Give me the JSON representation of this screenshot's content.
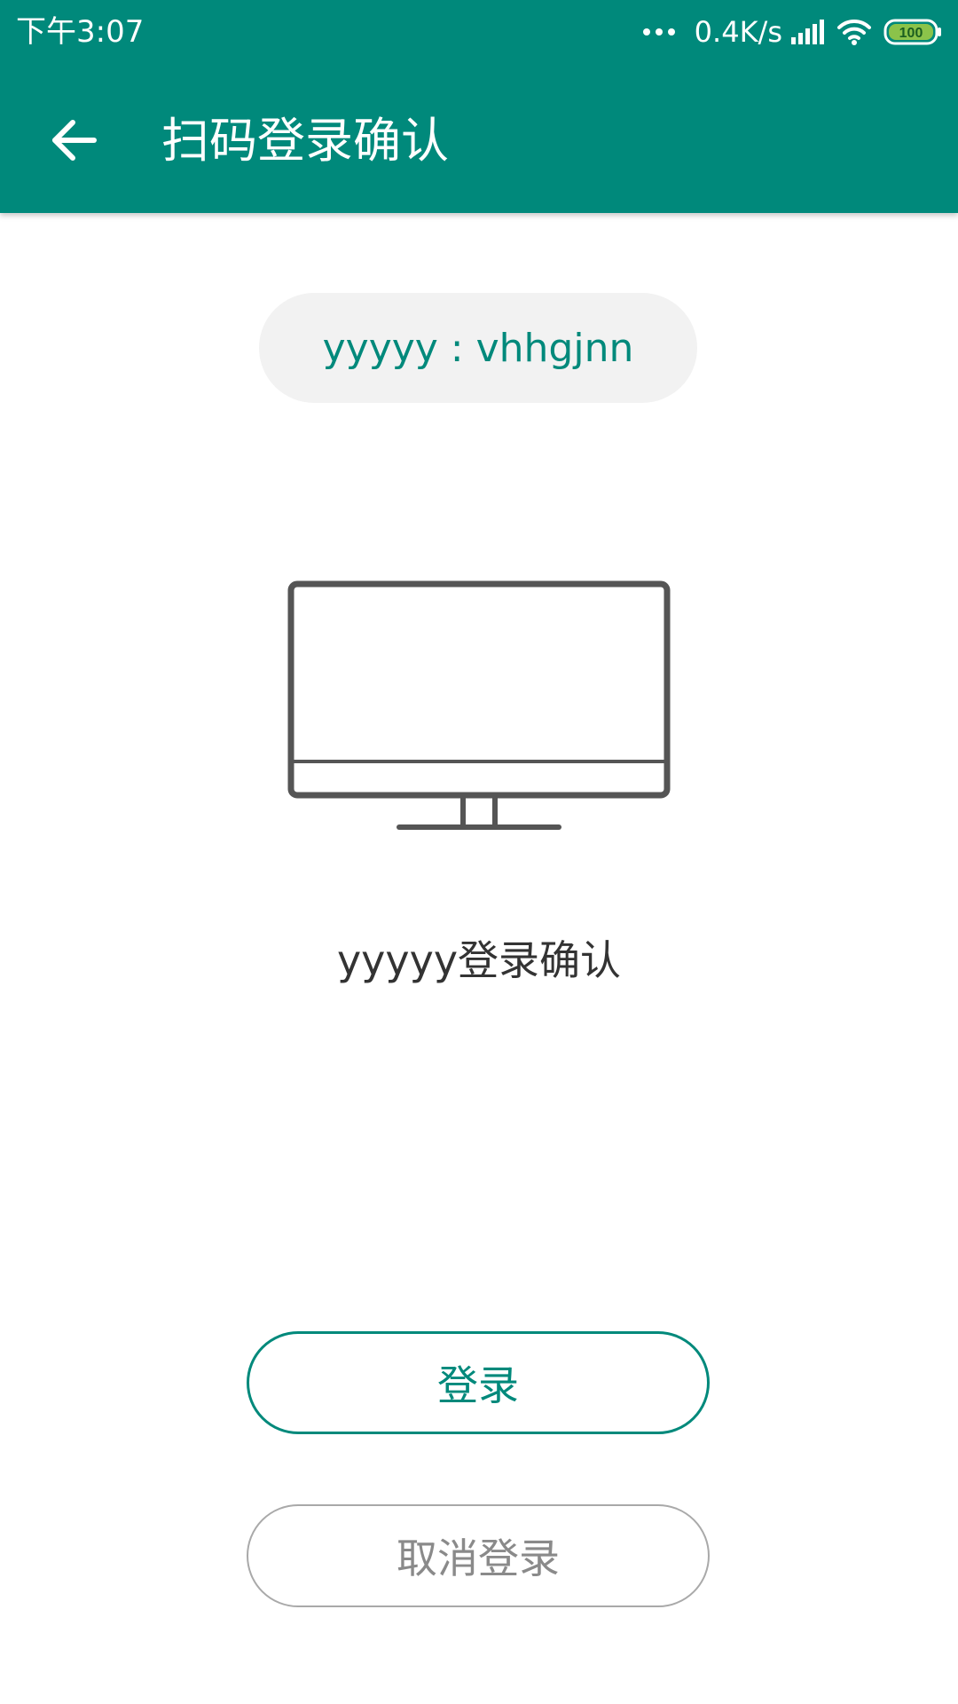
{
  "status_bar": {
    "time": "下午3:07",
    "net_speed": "0.4K/s",
    "battery": "100",
    "icons": [
      "more-dots-icon",
      "signal-icon",
      "wifi-icon",
      "battery-icon"
    ]
  },
  "app_bar": {
    "title": "扫码登录确认",
    "back_icon": "arrow-back-icon"
  },
  "account": {
    "label": "yyyyy : vhhgjnn"
  },
  "illustration": {
    "icon": "monitor-icon"
  },
  "confirm_message": "yyyyy登录确认",
  "buttons": {
    "login": "登录",
    "cancel": "取消登录"
  },
  "colors": {
    "primary": "#00897b",
    "pill_bg": "#f2f2f2",
    "text": "#333333",
    "cancel_text": "#8a8a8a",
    "battery_fill": "#8bc34a"
  }
}
